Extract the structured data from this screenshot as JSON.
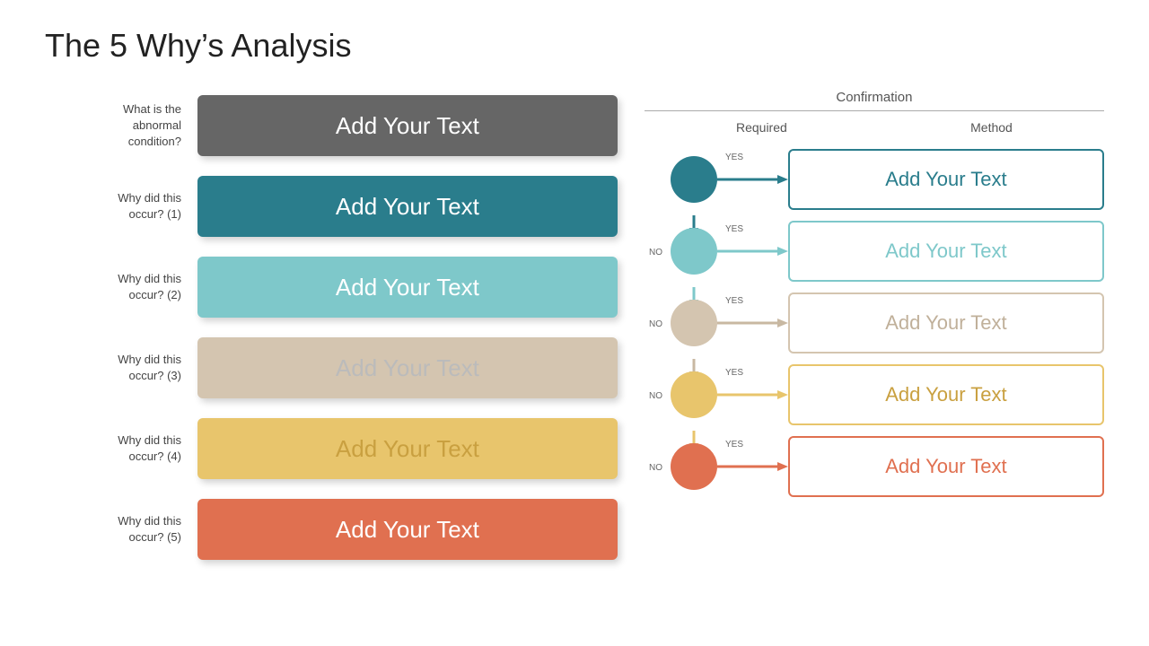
{
  "title": "The 5 Why’s Analysis",
  "confirmation_header": "Confirmation",
  "col_required": "Required",
  "col_method": "Method",
  "rows": [
    {
      "label": "What is the abnormal condition?",
      "box_text": "Add Your Text",
      "box_class": "box-gray",
      "show_flow": false
    },
    {
      "label": "Why did this occur? (1)",
      "box_text": "Add Your Text",
      "box_class": "box-teal",
      "show_flow": true,
      "circle_class": "c-teal",
      "arrow_color": "#2a7d8c",
      "conf_text": "Add Your Text",
      "conf_class": "cbox-teal",
      "show_no_arrow": false
    },
    {
      "label": "Why did this occur? (2)",
      "box_text": "Add Your Text",
      "box_class": "box-ltblue",
      "show_flow": true,
      "circle_class": "c-ltblue",
      "arrow_color": "#7ec8ca",
      "conf_text": "Add Your Text",
      "conf_class": "cbox-ltblue",
      "show_no_arrow": true
    },
    {
      "label": "Why did this occur? (3)",
      "box_text": "Add Your Text",
      "box_class": "box-beige",
      "show_flow": true,
      "circle_class": "c-beige",
      "arrow_color": "#c8b8a2",
      "conf_text": "Add Your Text",
      "conf_class": "cbox-beige",
      "show_no_arrow": true
    },
    {
      "label": "Why did this occur? (4)",
      "box_text": "Add Your Text",
      "box_class": "box-yellow",
      "show_flow": true,
      "circle_class": "c-yellow",
      "arrow_color": "#e8c56c",
      "conf_text": "Add Your Text",
      "conf_class": "cbox-yellow",
      "show_no_arrow": true
    },
    {
      "label": "Why did this occur? (5)",
      "box_text": "Add Your Text",
      "box_class": "box-orange",
      "show_flow": true,
      "circle_class": "c-orange",
      "arrow_color": "#e07050",
      "conf_text": "Add Your Text",
      "conf_class": "cbox-orange",
      "show_no_arrow": true
    }
  ]
}
